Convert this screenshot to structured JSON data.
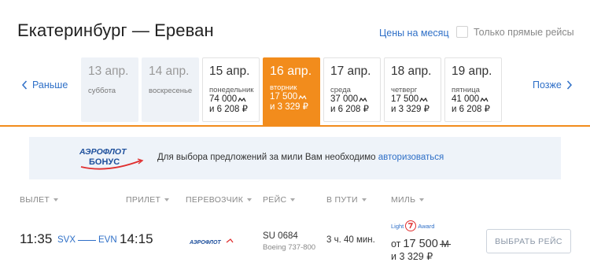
{
  "route_title": "Екатеринбург — Ереван",
  "month_prices_link": "Цены на месяц",
  "direct_only_label": "Только прямые рейсы",
  "nav": {
    "prev_label": "Раньше",
    "next_label": "Позже"
  },
  "days": [
    {
      "date": "13 апр.",
      "dow": "суббота",
      "miles": "",
      "price": "",
      "state": "disabled"
    },
    {
      "date": "14 апр.",
      "dow": "воскресенье",
      "miles": "",
      "price": "",
      "state": "disabled"
    },
    {
      "date": "15 апр.",
      "dow": "понедельник",
      "miles": "74 000",
      "price": "и 6 208 ₽",
      "state": "normal"
    },
    {
      "date": "16 апр.",
      "dow": "вторник",
      "miles": "17 500",
      "price": "и 3 329 ₽",
      "state": "active"
    },
    {
      "date": "17 апр.",
      "dow": "среда",
      "miles": "37 000",
      "price": "и 6 208 ₽",
      "state": "normal"
    },
    {
      "date": "18 апр.",
      "dow": "четверг",
      "miles": "17 500",
      "price": "и 3 329 ₽",
      "state": "normal"
    },
    {
      "date": "19 апр.",
      "dow": "пятница",
      "miles": "41 000",
      "price": "и 6 208 ₽",
      "state": "normal"
    }
  ],
  "banner": {
    "logo_line1": "АЭРОФЛОТ",
    "logo_line2": "БОНУС",
    "text": "Для выбора предложений за мили Вам необходимо ",
    "link": "авторизоваться"
  },
  "columns": {
    "departure": "ВЫЛЕТ",
    "arrival": "ПРИЛЕТ",
    "carrier": "ПЕРЕВОЗЧИК",
    "flight": "РЕЙС",
    "duration": "В ПУТИ",
    "miles": "МИЛЬ"
  },
  "flight": {
    "dep_time": "11:35",
    "dep_code": "SVX",
    "arr_code": "EVN",
    "arr_time": "14:15",
    "carrier_logo_text": "АЭРОФЛОТ",
    "number": "SU 0684",
    "aircraft": "Boeing 737-800",
    "duration": "3 ч. 40 мин.",
    "award_left": "Light",
    "award_right": "Award",
    "miles_prefix": "от",
    "miles": "17 500",
    "mile_symbol": "M",
    "rub": "и 3 329 ₽",
    "select_button": "ВЫБРАТЬ РЕЙС"
  },
  "colors": {
    "accent": "#f28c1c",
    "link": "#2e6fc7",
    "banner_bg": "#eef3f9",
    "disabled_day_bg": "#eef2f7"
  }
}
